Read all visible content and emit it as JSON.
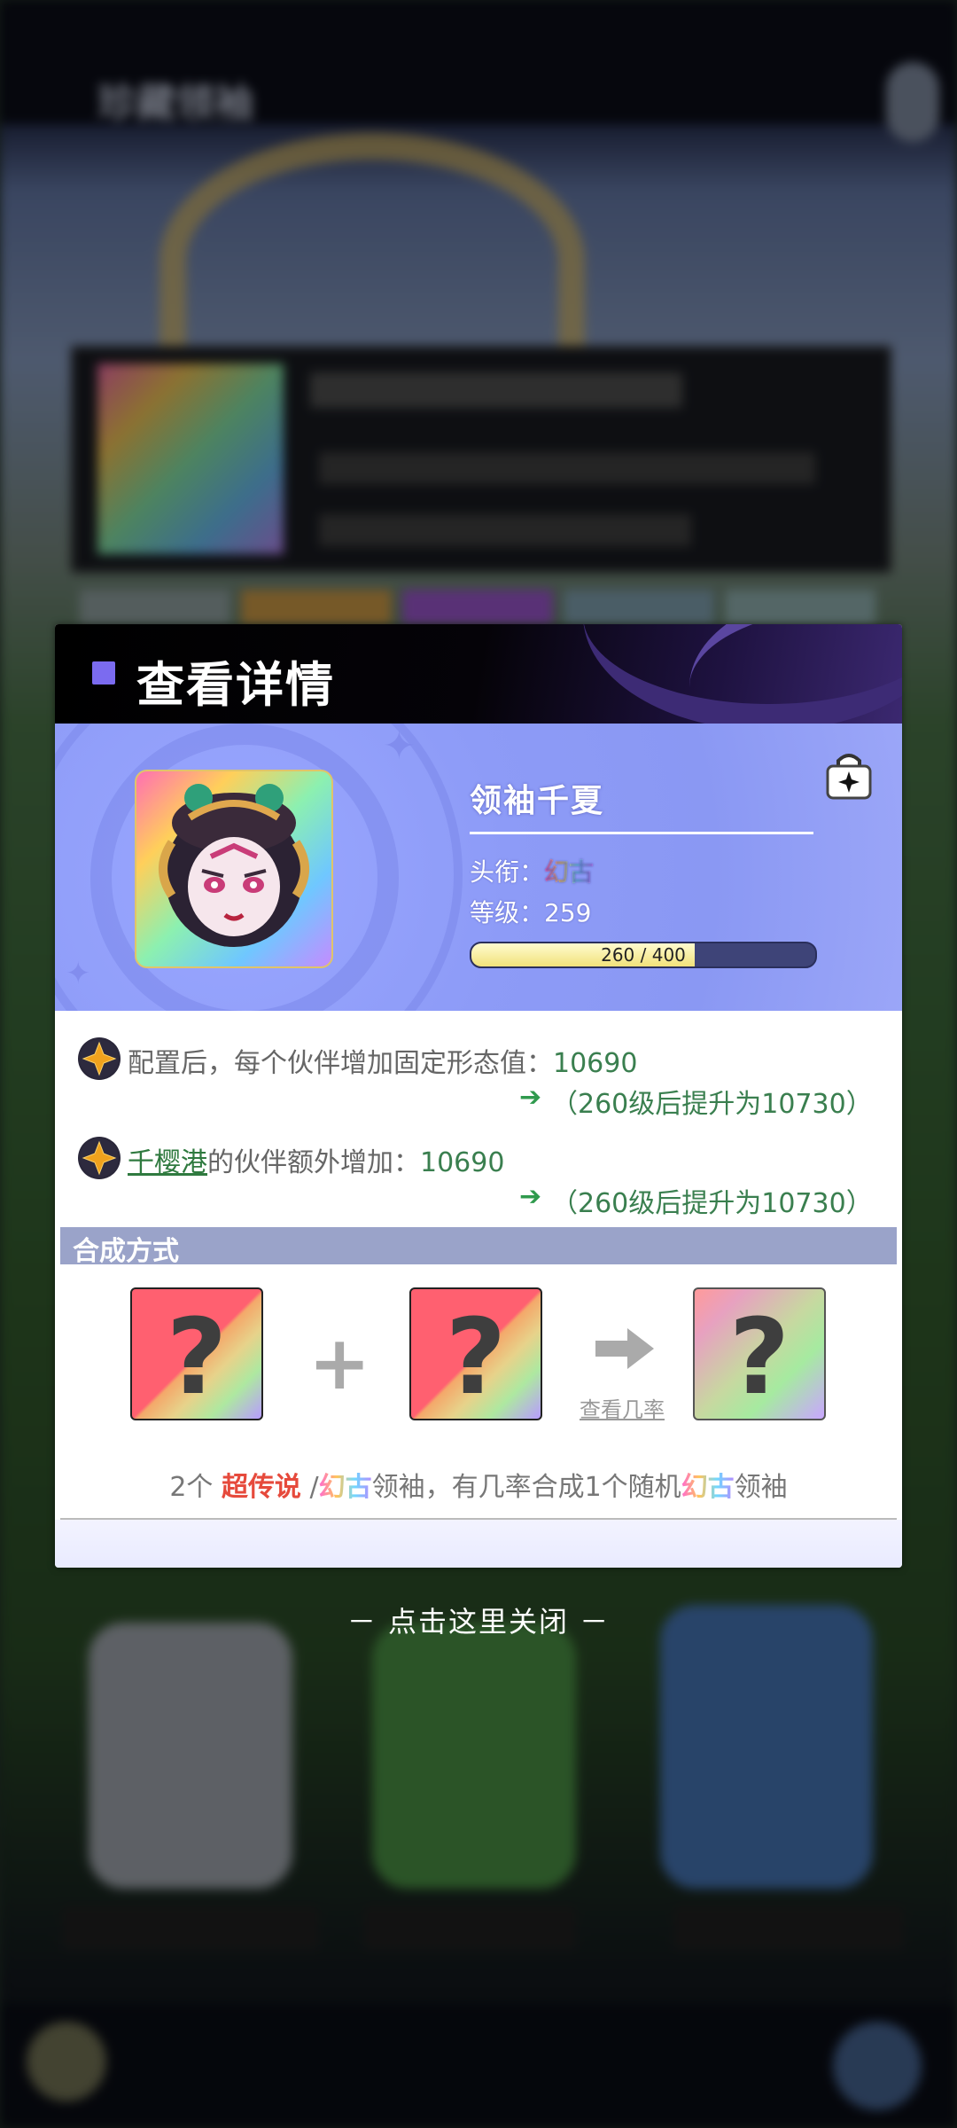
{
  "background": {
    "screen_title": "珍藏领袖"
  },
  "dialog": {
    "title": "查看详情",
    "leader": {
      "name": "领袖千夏",
      "title_label": "头衔：",
      "title_value": "幻古",
      "level_label": "等级：",
      "level_value": "259",
      "xp_current": 260,
      "xp_max": 400,
      "xp_text": "260 / 400"
    },
    "effects": [
      {
        "prefix": "配置后，每个伙伴增加固定形态值：",
        "value": "10690",
        "upgrade_note": "（260级后提升为10730）"
      },
      {
        "link": "千樱港",
        "prefix": "的伙伴额外增加：",
        "value": "10690",
        "upgrade_note": "（260级后提升为10730）"
      }
    ],
    "synthesis": {
      "section_title": "合成方式",
      "card_symbol": "?",
      "plus_symbol": "+",
      "odds_link": "查看几率",
      "desc_part1": "2个 ",
      "desc_red": "超传说",
      "desc_part2": " /",
      "desc_rainbow1": "幻古",
      "desc_part3": "领袖，有几率合成1个随机",
      "desc_rainbow2": "幻古",
      "desc_part4": "领袖"
    }
  },
  "close_hint": "－ 点击这里关闭 －",
  "colors": {
    "accent_square": "#7b6bf0",
    "panel_blue": "#8d9bf7",
    "effect_green": "#3a7f4f",
    "arrow_green": "#2f9a4d",
    "legend_red": "#e64a3c"
  }
}
